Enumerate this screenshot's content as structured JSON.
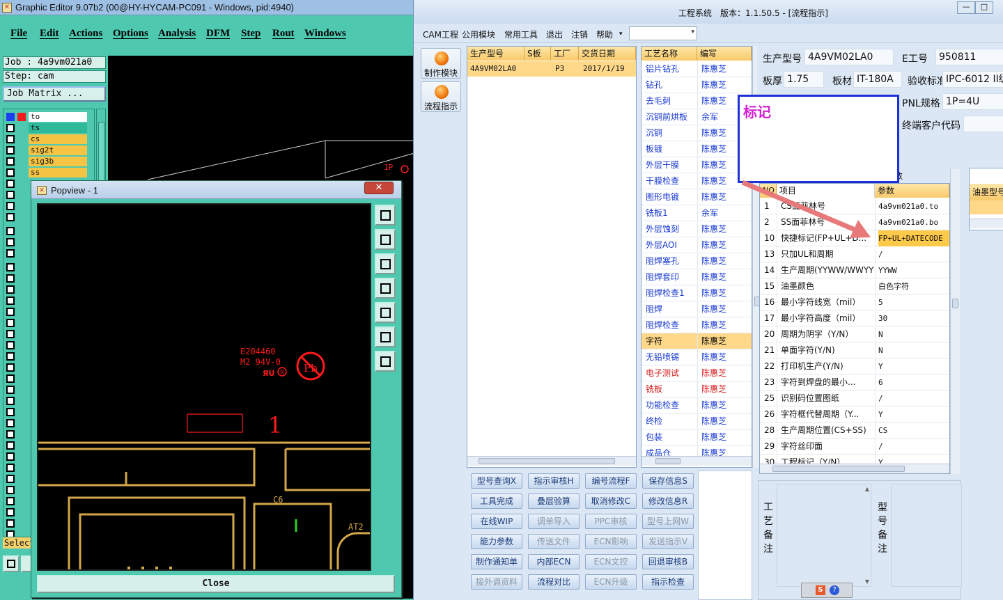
{
  "graphic_editor": {
    "title": "Graphic Editor 9.07b2 (00@HY-HYCAM-PC091 - Windows, pid:4940)",
    "menu": [
      "File",
      "Edit",
      "Actions",
      "Options",
      "Analysis",
      "DFM",
      "Step",
      "Rout",
      "Windows"
    ],
    "job": "Job : 4a9vm021a0",
    "step": "Step: cam",
    "job_matrix": "Job Matrix ...",
    "layers": [
      {
        "name": "to",
        "color": "#ffffff"
      },
      {
        "name": "ts",
        "color": "#2fb89a"
      },
      {
        "name": "cs",
        "color": "#f6c445"
      },
      {
        "name": "sig2t",
        "color": "#f6c445"
      },
      {
        "name": "sig3b",
        "color": "#f6c445"
      },
      {
        "name": "ss",
        "color": "#f6c445"
      }
    ],
    "select_label": "Select",
    "canvas_annotation": "1P",
    "canvas_annotation_color": "#ff2020"
  },
  "popview": {
    "title": "Popview - 1",
    "close_button": "Close",
    "marking": {
      "ul_text_line1": "E204460",
      "ul_text_line2": "M2 94V-0",
      "pb_text": "Pb",
      "number_label": "1",
      "ref_c6": "C6",
      "ref_at2": "AT2"
    },
    "colors": {
      "marking": "#ff1a1a",
      "copper": "#d4a84a",
      "pad": "#c89b3c"
    }
  },
  "eng": {
    "title": "工程系统　版本：1.1.50.5 - [流程指示]",
    "menu": [
      "CAM工程",
      "公用模块",
      "常用工具",
      "退出",
      "注销",
      "帮助"
    ],
    "side_buttons": [
      "制作模块",
      "流程指示"
    ],
    "product_grid": {
      "headers": [
        "生产型号",
        "S板",
        "工厂",
        "交货日期"
      ],
      "row": {
        "model": "4A9VM02LA0",
        "s_board": "",
        "factory": "P3",
        "delivery": "2017/1/19"
      }
    },
    "process_grid": {
      "headers": [
        "工艺名称",
        "编写"
      ],
      "rows": [
        {
          "name": "铝片钻孔",
          "writer": "陈惠芝"
        },
        {
          "name": "钻孔",
          "writer": "陈惠芝"
        },
        {
          "name": "去毛刺",
          "writer": "陈惠芝"
        },
        {
          "name": "沉铜前烘板",
          "writer": "余军"
        },
        {
          "name": "沉铜",
          "writer": "陈惠芝"
        },
        {
          "name": "板镀",
          "writer": "陈惠芝"
        },
        {
          "name": "外层干膜",
          "writer": "陈惠芝"
        },
        {
          "name": "干膜检查",
          "writer": "陈惠芝"
        },
        {
          "name": "图形电镀",
          "writer": "陈惠芝"
        },
        {
          "name": "铣板1",
          "writer": "余军"
        },
        {
          "name": "外层蚀刻",
          "writer": "陈惠芝"
        },
        {
          "name": "外层AOI",
          "writer": "陈惠芝"
        },
        {
          "name": "阻焊塞孔",
          "writer": "陈惠芝"
        },
        {
          "name": "阻焊套印",
          "writer": "陈惠芝"
        },
        {
          "name": "阻焊检查1",
          "writer": "陈惠芝"
        },
        {
          "name": "阻焊",
          "writer": "陈惠芝"
        },
        {
          "name": "阻焊检查",
          "writer": "陈惠芝"
        },
        {
          "name": "字符",
          "writer": "陈惠芝"
        },
        {
          "name": "无铅喷锡",
          "writer": "陈惠芝"
        },
        {
          "name": "电子测试",
          "writer": "陈惠芝"
        },
        {
          "name": "铣板",
          "writer": "陈惠芝"
        },
        {
          "name": "功能检查",
          "writer": "陈惠芝"
        },
        {
          "name": "终检",
          "writer": "陈惠芝"
        },
        {
          "name": "包装",
          "writer": "陈惠芝"
        },
        {
          "name": "成品仓",
          "writer": "陈惠芝"
        }
      ],
      "selected_index": 17,
      "red_indices": [
        19,
        20
      ]
    },
    "action_buttons": [
      [
        "型号查询X",
        "指示审核H",
        "编号流程F",
        "保存信息S"
      ],
      [
        "工具完成",
        "叠层验算",
        "取消修改C",
        "修改信息R"
      ],
      [
        "在线WIP",
        "调单导入",
        "PPC审核",
        "型号上网W"
      ],
      [
        "能力参数",
        "传送文件",
        "ECN影响",
        "发送指示V"
      ],
      [
        "制作通知单",
        "内部ECN",
        "ECN文控",
        "回退审核B"
      ],
      [
        "接外调资料",
        "流程对比",
        "ECN升级",
        "指示检查"
      ]
    ],
    "disabled_buttons": [
      "调单导入",
      "PPC审核",
      "型号上网W",
      "传送文件",
      "ECN影响",
      "发送指示V",
      "ECN文控",
      "接外调资料",
      "ECN升级"
    ],
    "info": {
      "model_label": "生产型号",
      "model_value": "4A9VM02LA0",
      "eno_label": "E工号",
      "eno_value": "950811",
      "thickness_label": "板厚",
      "thickness_value": "1.75",
      "material_label": "板材",
      "material_value": "IT-180A",
      "standard_label": "验收标准",
      "standard_value": "IPC-6012 II级",
      "pnl_label": "PNL规格",
      "pnl_value": "1P=4U",
      "endcust_label": "终端客户代码",
      "endcust_value": ""
    },
    "note_popup": "标记",
    "param_grid": {
      "caption": "参数",
      "headers": [
        "NO",
        "项目",
        "参数"
      ],
      "rows": [
        {
          "no": "1",
          "item": "CS面菲林号",
          "value": "4a9vm021a0.to"
        },
        {
          "no": "2",
          "item": "SS面菲林号",
          "value": "4a9vm021a0.bo"
        },
        {
          "no": "10",
          "item": "快捷标记(FP+UL+D...",
          "value": "FP+UL+DATECODE"
        },
        {
          "no": "13",
          "item": "只加UL和周期",
          "value": "/"
        },
        {
          "no": "14",
          "item": "生产周期(YYWW/WWYY)",
          "value": "YYWW"
        },
        {
          "no": "15",
          "item": "油墨颜色",
          "value": "白色字符"
        },
        {
          "no": "16",
          "item": "最小字符线宽（mil）",
          "value": "5"
        },
        {
          "no": "17",
          "item": "最小字符高度（mil）",
          "value": "30"
        },
        {
          "no": "20",
          "item": "周期为阴字（Y/N）",
          "value": "N"
        },
        {
          "no": "21",
          "item": "单面字符(Y/N)",
          "value": "N"
        },
        {
          "no": "22",
          "item": "打印机生产(Y/N)",
          "value": "Y"
        },
        {
          "no": "23",
          "item": "字符到焊盘的最小...",
          "value": "6"
        },
        {
          "no": "25",
          "item": "识别码位置图纸",
          "value": "/"
        },
        {
          "no": "26",
          "item": "字符框代替周期（Y...",
          "value": "Y"
        },
        {
          "no": "28",
          "item": "生产周期位置(CS+SS)",
          "value": "CS"
        },
        {
          "no": "29",
          "item": "字符丝印面",
          "value": "/"
        },
        {
          "no": "30",
          "item": "工程标记（Y/N）",
          "value": "Y"
        }
      ],
      "highlight_index": 2
    },
    "ink_grid_header": "油墨型号",
    "remarks": {
      "process": "工艺备注",
      "model": "型号备注"
    },
    "accent_arrow_color": "#e8797a"
  }
}
